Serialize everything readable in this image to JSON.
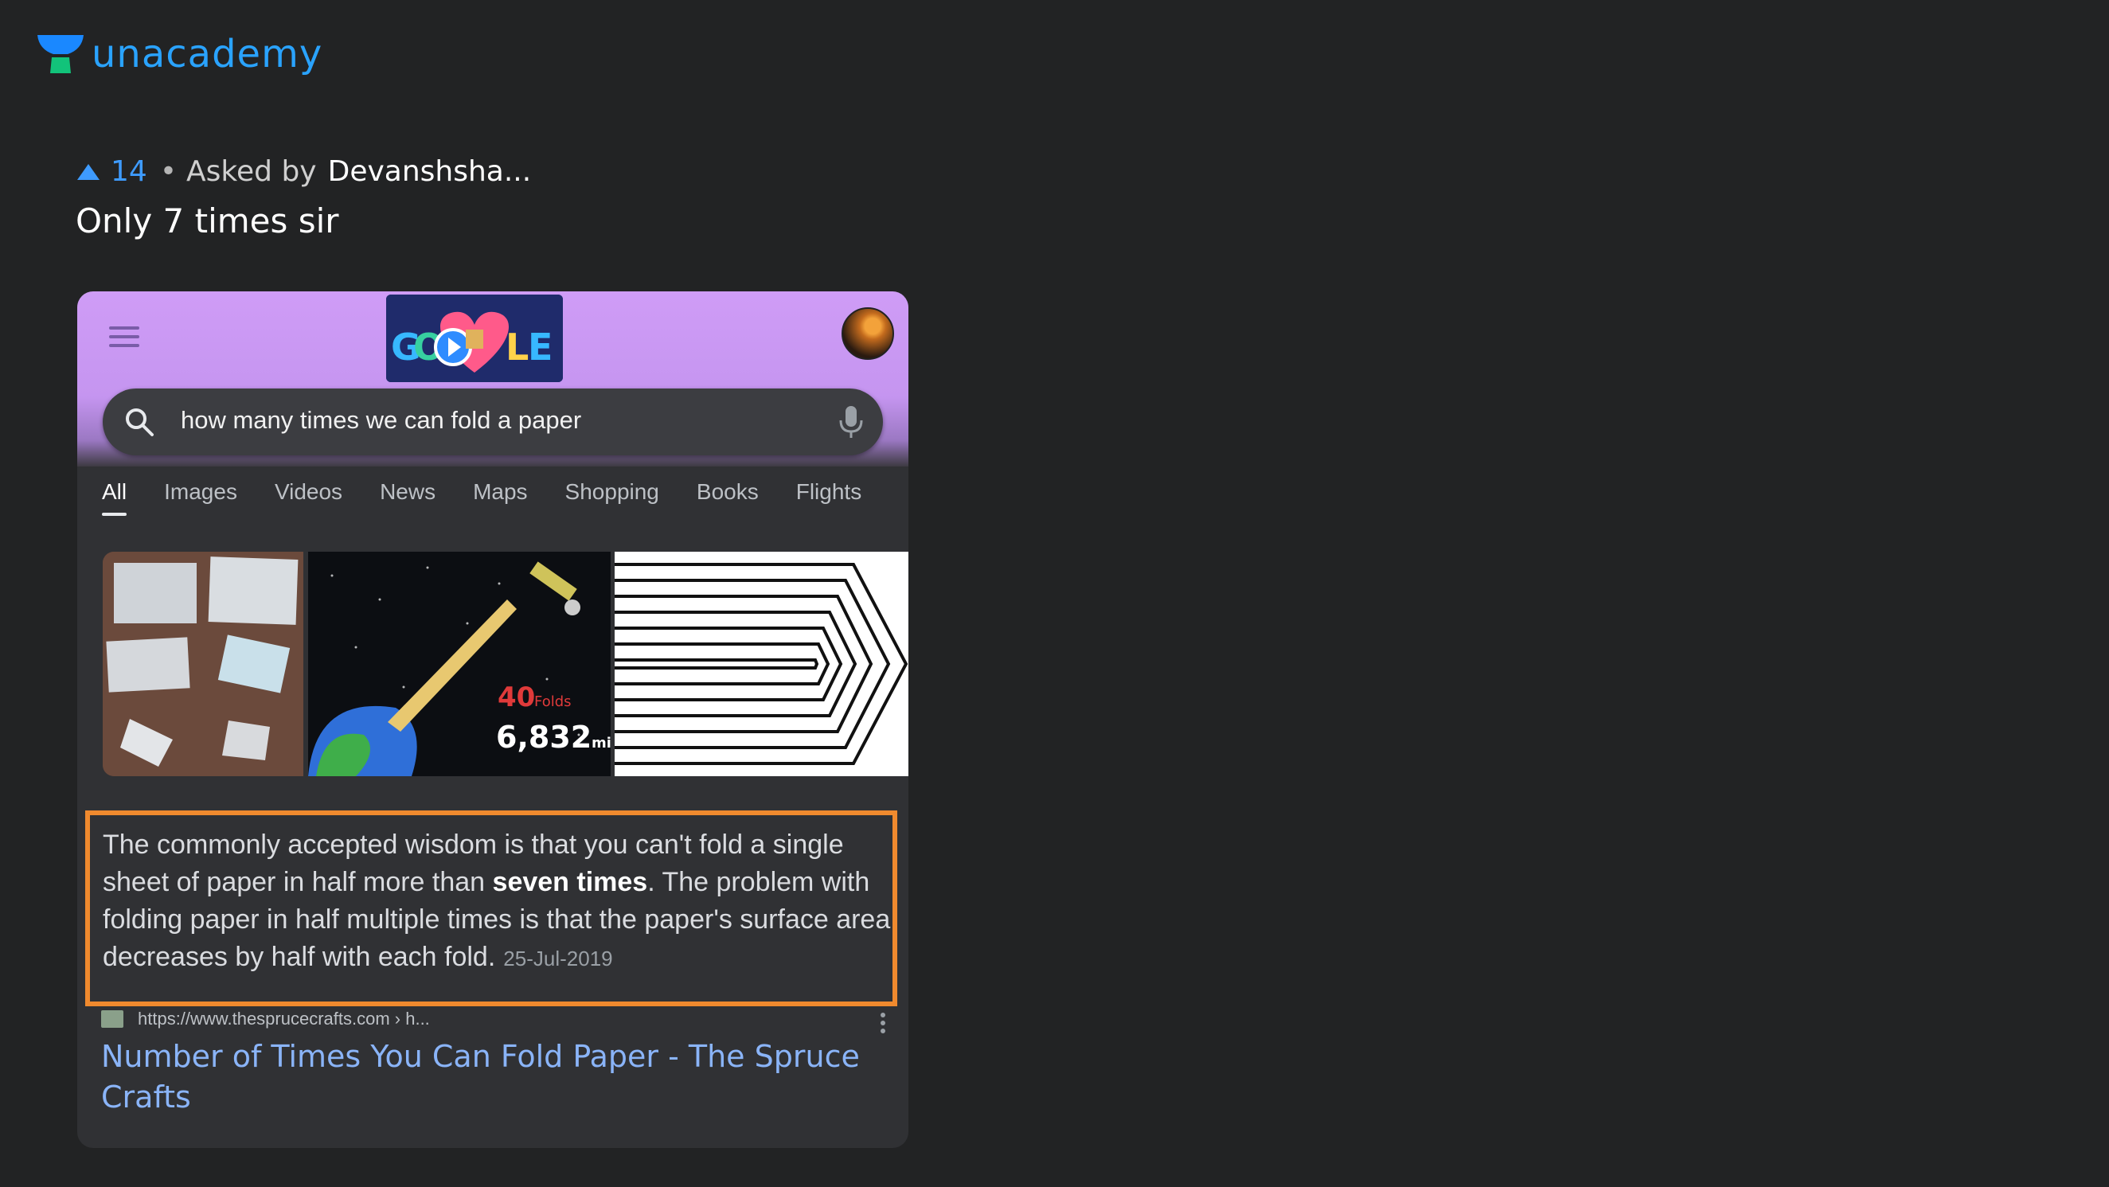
{
  "brand": {
    "name": "unacademy",
    "logo_icon": "unacademy-cap-icon",
    "color": "#2aa3ff"
  },
  "question": {
    "upvotes": "14",
    "separator": "•",
    "asked_by_label": "Asked by",
    "asked_by_user": "Devanshsha...",
    "text": "Only 7 times sir"
  },
  "screenshot": {
    "search_query": "how many times we can fold a paper",
    "tabs": [
      "All",
      "Images",
      "Videos",
      "News",
      "Maps",
      "Shopping",
      "Books",
      "Flights"
    ],
    "active_tab": "All",
    "image_overlay": {
      "count": "40",
      "unit": "Folds",
      "distance": "6,832",
      "distance_unit": "mi"
    },
    "snippet": {
      "part1": "The commonly accepted wisdom is that you can't fold a single sheet of paper in half more than ",
      "bold": "seven times",
      "part2": ". The problem with folding paper in half multiple times is that the paper's surface area decreases by half with each fold.",
      "date": "25-Jul-2019"
    },
    "result": {
      "url": "https://www.thesprucecrafts.com › h...",
      "title": "Number of Times You Can Fold Paper - The Spruce Crafts"
    },
    "highlight_color": "#f08a2e",
    "header_color": "#c99af4"
  }
}
